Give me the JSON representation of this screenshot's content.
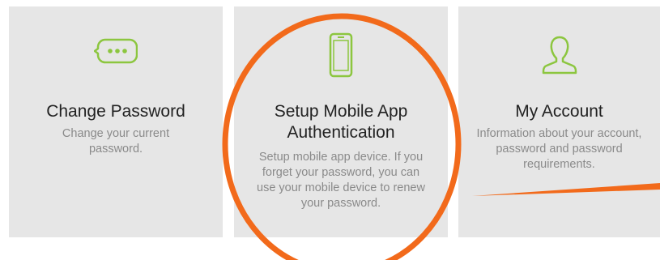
{
  "tiles": [
    {
      "title": "Change Password",
      "description": "Change your current password.",
      "icon": "chat-bubble-dots-icon"
    },
    {
      "title": "Setup Mobile App Authentication",
      "description": "Setup mobile app device. If you forget your password, you can use your mobile device to renew your password.",
      "icon": "smartphone-icon"
    },
    {
      "title": "My Account",
      "description": "Information about your account, password and password requirements.",
      "icon": "user-icon"
    }
  ],
  "colors": {
    "tile_background": "#e6e6e6",
    "icon_green": "#8cc63f",
    "title_text": "#222222",
    "description_text": "#8a8a8a",
    "annotation_orange": "#f26a1b"
  }
}
